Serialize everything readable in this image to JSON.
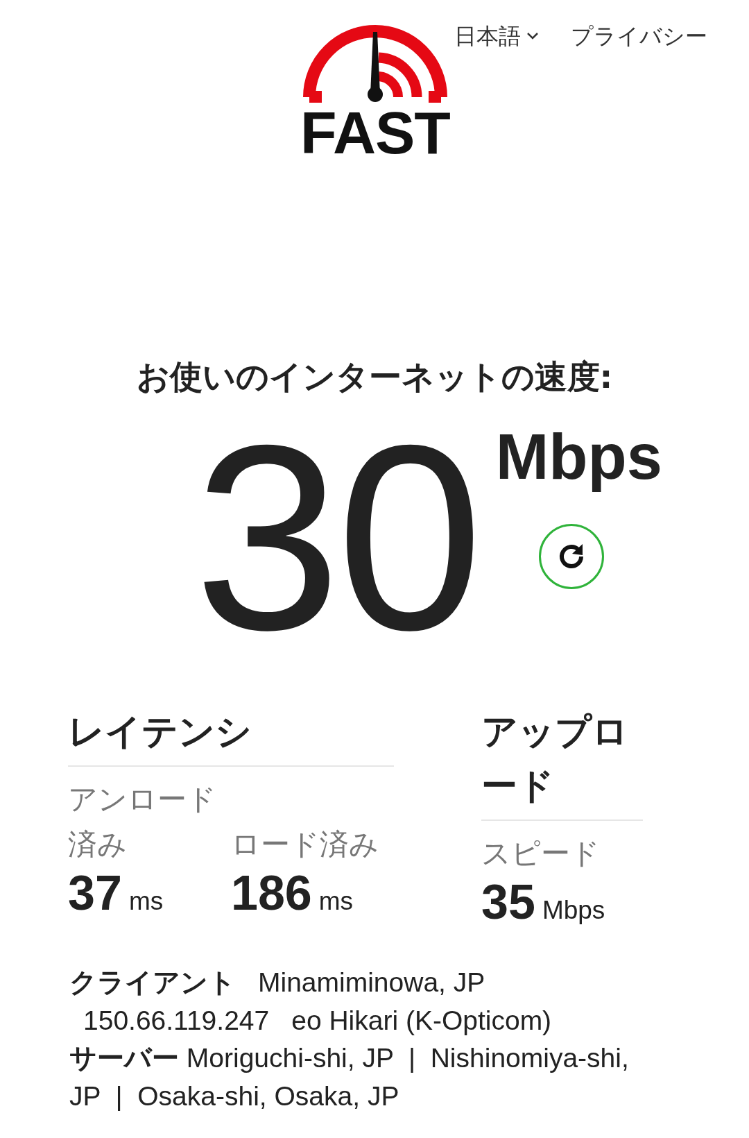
{
  "header": {
    "language": "日本語",
    "privacy_link": "プライバシー"
  },
  "logo": {
    "text": "FAST"
  },
  "speed": {
    "heading": "お使いのインターネットの速度:",
    "value": "30",
    "unit": "Mbps"
  },
  "latency": {
    "title": "レイテンシ",
    "metrics": [
      {
        "label": "アンロード済み",
        "value": "37",
        "unit": "ms"
      },
      {
        "label": "ロード済み",
        "value": "186",
        "unit": "ms"
      }
    ]
  },
  "upload": {
    "title": "アップロード",
    "metrics": [
      {
        "label": "スピード",
        "value": "35",
        "unit": "Mbps"
      }
    ]
  },
  "client": {
    "label": "クライアント",
    "location": "Minamiminowa, JP",
    "ip": "150.66.119.247",
    "isp": "eo Hikari (K-Opticom)"
  },
  "server": {
    "text": "**サーバー** Moriguchi-shi, JP  |  Nishinomiya-shi, JP  |  Osaka-shi, Osaka, JP"
  }
}
